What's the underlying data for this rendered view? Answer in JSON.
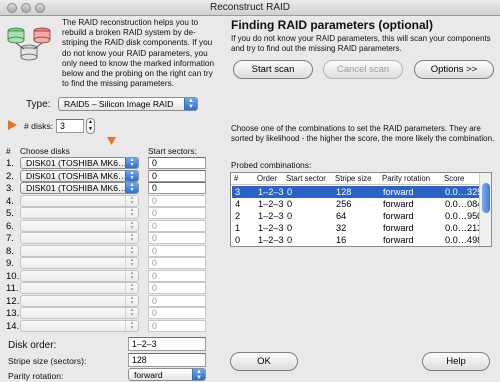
{
  "window": {
    "title": "Reconstruct RAID"
  },
  "intro_text": "The RAID reconstruction helps you to rebuild a broken RAID system by de-striping the RAID disk components. If you do not know your RAID parameters, you only need to know the marked information below and the probing on the right can try to find the missing parameters.",
  "type": {
    "label": "Type:",
    "value": "RAID5 – Silicon Image RAID"
  },
  "disks": {
    "label": "# disks:",
    "value": "3"
  },
  "columns": {
    "num": "#",
    "choose": "Choose disks",
    "start": "Start sectors:"
  },
  "rows": [
    {
      "num": "1.",
      "disk": "DISK01 (TOSHIBA MK6…",
      "start": "0"
    },
    {
      "num": "2.",
      "disk": "DISK01 (TOSHIBA MK6…",
      "start": "0"
    },
    {
      "num": "3.",
      "disk": "DISK01 (TOSHIBA MK6…",
      "start": "0"
    },
    {
      "num": "4.",
      "disk": "",
      "start": "0"
    },
    {
      "num": "5.",
      "disk": "",
      "start": "0"
    },
    {
      "num": "6.",
      "disk": "",
      "start": "0"
    },
    {
      "num": "7.",
      "disk": "",
      "start": "0"
    },
    {
      "num": "8.",
      "disk": "",
      "start": "0"
    },
    {
      "num": "9.",
      "disk": "",
      "start": "0"
    },
    {
      "num": "10.",
      "disk": "",
      "start": "0"
    },
    {
      "num": "11.",
      "disk": "",
      "start": "0"
    },
    {
      "num": "12.",
      "disk": "",
      "start": "0"
    },
    {
      "num": "13.",
      "disk": "",
      "start": "0"
    },
    {
      "num": "14.",
      "disk": "",
      "start": "0"
    }
  ],
  "bottom_left": {
    "disk_order_label": "Disk order:",
    "disk_order_value": "1–2–3",
    "stripe_label": "Stripe size (sectors):",
    "stripe_value": "128",
    "parity_label": "Parity rotation:",
    "parity_value": "forward"
  },
  "right": {
    "heading": "Finding RAID parameters (optional)",
    "desc": "If you do not know your RAID parameters, this will scan your components and try to find out the missing RAID parameters.",
    "start_scan": "Start scan",
    "cancel_scan": "Cancel scan",
    "options": "Options >>",
    "choose_text": "Choose one of the combinations to set the RAID parameters. They are sorted by likelihood - the higher the score, the more likely the combination.",
    "probed_label": "Probed combinations:"
  },
  "table": {
    "headers": [
      "#",
      "Order",
      "Start sector",
      "Stripe size",
      "Parity rotation",
      "Score"
    ],
    "rows": [
      [
        "3",
        "1–2–3",
        "0",
        "128",
        "forward",
        "0.0…325"
      ],
      [
        "4",
        "1–2–3",
        "0",
        "256",
        "forward",
        "0.0…084"
      ],
      [
        "2",
        "1–2–3",
        "0",
        "64",
        "forward",
        "0.0…950"
      ],
      [
        "1",
        "1–2–3",
        "0",
        "32",
        "forward",
        "0.0…213"
      ],
      [
        "0",
        "1–2–3",
        "0",
        "16",
        "forward",
        "0.0…498"
      ]
    ],
    "selected_row": 0
  },
  "buttons": {
    "ok": "OK",
    "help": "Help"
  },
  "colors": {
    "accent": "#2b62c7",
    "marker": "#e8731e"
  }
}
